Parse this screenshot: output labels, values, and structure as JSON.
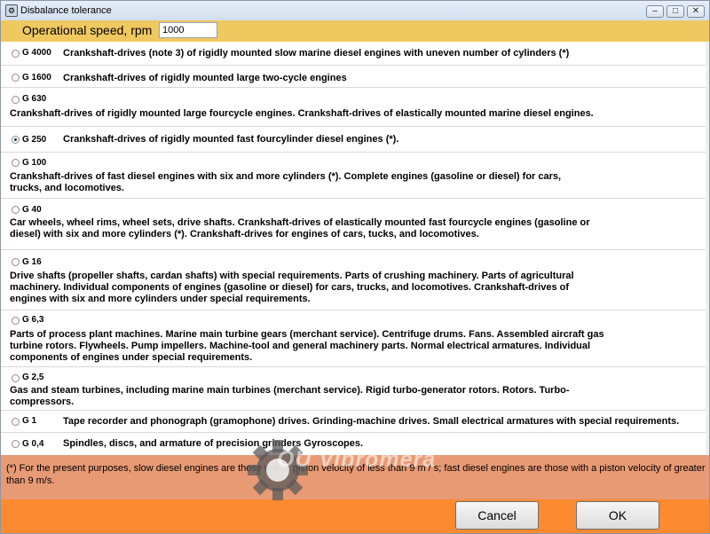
{
  "window": {
    "title": "Disbalance tolerance"
  },
  "speed": {
    "label": "Operational speed, rpm",
    "value": "1000"
  },
  "grades": [
    {
      "grade": "G 4000",
      "desc": "Crankshaft-drives (note 3) of rigidly mounted slow marine diesel engines with uneven number of cylinders (*)",
      "checked": false
    },
    {
      "grade": "G 1600",
      "desc": "Crankshaft-drives of rigidly mounted large two-cycle engines",
      "checked": false
    },
    {
      "grade": "G 630",
      "desc": "Crankshaft-drives of rigidly mounted large fourcycle engines. Crankshaft-drives of elastically mounted marine diesel engines.",
      "checked": false
    },
    {
      "grade": "G 250",
      "desc": "Crankshaft-drives of rigidly mounted fast fourcylinder diesel engines (*).",
      "checked": true
    },
    {
      "grade": "G 100",
      "desc": "Crankshaft-drives of fast diesel engines with six and more cylinders (*). Complete engines (gasoline or diesel) for cars, trucks, and locomotives.",
      "checked": false
    },
    {
      "grade": "G 40",
      "desc": "Car wheels, wheel rims, wheel sets, drive shafts. Crankshaft-drives of elastically mounted fast fourcycle engines (gasoline or diesel) with six and more cylinders (*). Crankshaft-drives for engines of cars, tucks, and locomotives.",
      "checked": false
    },
    {
      "grade": "G 16",
      "desc": "Drive shafts (propeller shafts, cardan shafts) with special requirements. Parts of crushing machinery. Parts of agricultural machinery. Individual components of engines (gasoline or diesel) for cars, trucks, and locomotives. Crankshaft-drives of engines with six and more cylinders under special requirements.",
      "checked": false
    },
    {
      "grade": "G 6,3",
      "desc": " Parts of process plant machines. Marine main turbine gears (merchant service). Centrifuge drums. Fans. Assembled aircraft gas turbine rotors. Flywheels. Pump impellers. Machine-tool and general machinery parts. Normal electrical armatures. Individual components of engines under special requirements.",
      "checked": false
    },
    {
      "grade": "G 2,5",
      "desc": "Gas and steam turbines, including marine main turbines (merchant service). Rigid turbo-generator rotors. Rotors. Turbo-compressors.",
      "checked": false
    },
    {
      "grade": "G 1",
      "desc": "Tape recorder and phonograph (gramophone) drives. Grinding-machine drives. Small electrical armatures with special requirements.",
      "checked": false
    },
    {
      "grade": "G 0,4",
      "desc": "Spindles, discs, and armature of precision grinders Gyroscopes.",
      "checked": false
    }
  ],
  "footnote": "(*)  For the present purposes, slow diesel engines are those with a piston velocity of less than 9 m / s; fast diesel engines are those with a piston velocity of greater than 9 m/s.",
  "buttons": {
    "cancel": "Cancel",
    "ok": "OK"
  },
  "watermark": {
    "text": "OU Vibromera"
  },
  "colors": {
    "speedbar": "#f0c860",
    "footnote": "#e89a74",
    "bottombar": "#fb8a30",
    "radio_checked": "#1a2a55"
  }
}
